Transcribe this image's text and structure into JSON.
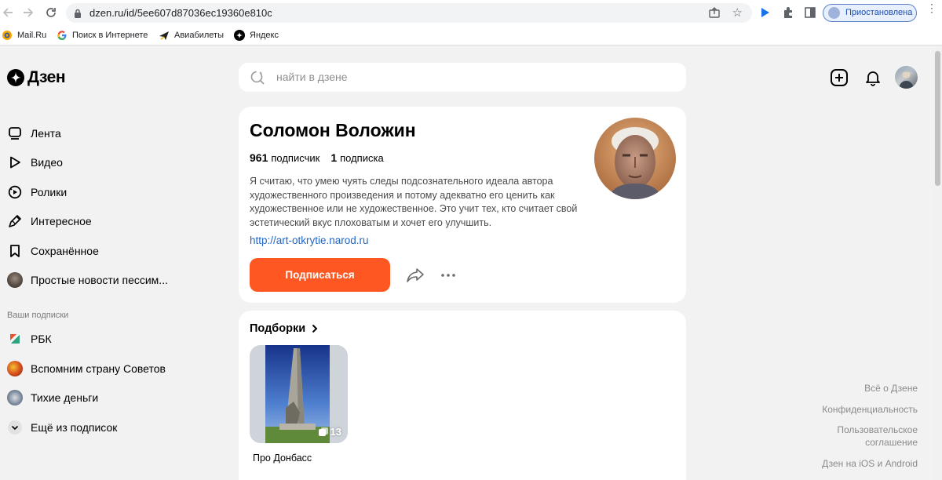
{
  "browser": {
    "url": "dzen.ru/id/5ee607d87036ec19360e810c",
    "profile_status": "Приостановлена",
    "bookmarks": [
      {
        "label": "Mail.Ru",
        "icon": "mailru-icon"
      },
      {
        "label": "Поиск в Интернете",
        "icon": "google-icon"
      },
      {
        "label": "Авиабилеты",
        "icon": "plane-icon"
      },
      {
        "label": "Яндекс",
        "icon": "dzen-logo-icon"
      }
    ]
  },
  "header": {
    "logo_text": "Дзен",
    "search_placeholder": "найти в дзене"
  },
  "sidebar": {
    "items": [
      {
        "label": "Лента",
        "icon": "feed-icon"
      },
      {
        "label": "Видео",
        "icon": "play-icon"
      },
      {
        "label": "Ролики",
        "icon": "shorts-icon"
      },
      {
        "label": "Интересное",
        "icon": "interesting-icon"
      },
      {
        "label": "Сохранённое",
        "icon": "bookmark-icon"
      },
      {
        "label": "Простые новости пессим...",
        "icon": "channel-avatar"
      }
    ],
    "subscriptions_heading": "Ваши подписки",
    "subscriptions": [
      {
        "label": "РБК",
        "icon": "rbc-logo"
      },
      {
        "label": "Вспомним страну Советов",
        "icon": "channel-avatar"
      },
      {
        "label": "Тихие деньги",
        "icon": "channel-avatar"
      },
      {
        "label": "Ещё из подписок",
        "icon": "chevron-down-icon"
      }
    ]
  },
  "profile": {
    "name": "Соломон Воложин",
    "subscribers_count": "961",
    "subscribers_label": "подписчик",
    "subscriptions_count": "1",
    "subscriptions_label": "подписка",
    "description": "Я считаю, что умею чуять следы подсознательного идеала автора художественного произведения и потому адекватно его ценить как художественное или не художественное. Это учит тех, кто считает свой эстетический вкус плоховатым и хочет его улучшить.",
    "link": "http://art-otkrytie.narod.ru",
    "subscribe_label": "Подписаться"
  },
  "collections": {
    "title": "Подборки",
    "items": [
      {
        "label": "Про Донбасс",
        "count": "13"
      }
    ]
  },
  "footer": {
    "links": [
      "Всё о Дзене",
      "Конфиденциальность",
      "Пользовательское соглашение",
      "Дзен на iOS и Android"
    ]
  },
  "colors": {
    "accent": "#fe5722",
    "link": "#2067c6",
    "page_bg": "#f2f2f2"
  }
}
